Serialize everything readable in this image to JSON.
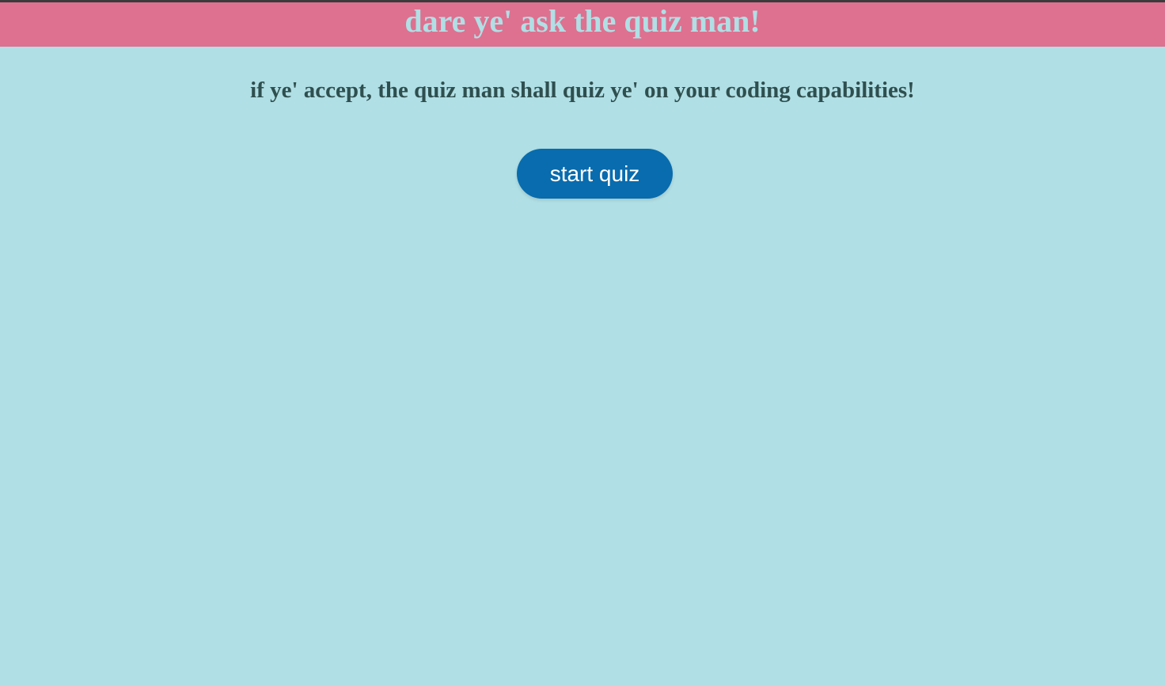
{
  "header": {
    "title": "dare ye' ask the quiz man!"
  },
  "main": {
    "subtitle": "if ye' accept, the quiz man shall quiz ye' on your coding capabilities!",
    "start_button_label": "start quiz"
  },
  "colors": {
    "background": "#b0dfe5",
    "header_bg": "#de7190",
    "header_text": "#b0dfe5",
    "subtitle_text": "#2f4f4f",
    "button_bg": "#086cae",
    "button_text": "#ffffff"
  }
}
